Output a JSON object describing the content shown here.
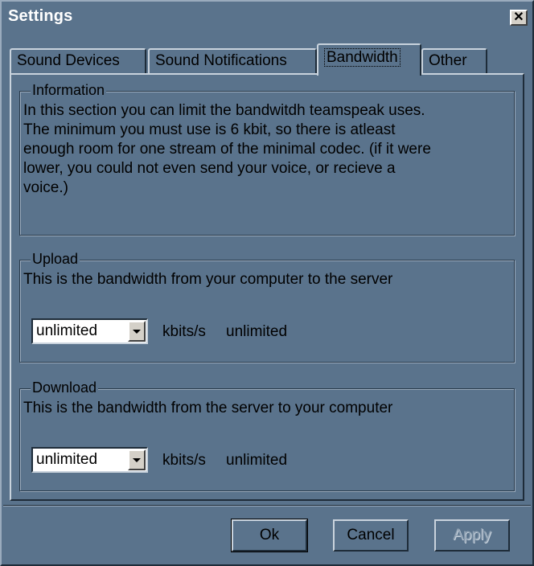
{
  "window": {
    "title": "Settings"
  },
  "tabs": [
    {
      "label": "Sound Devices"
    },
    {
      "label": "Sound Notifications"
    },
    {
      "label": "Bandwidth"
    },
    {
      "label": "Other"
    }
  ],
  "information": {
    "legend": "Information",
    "lines": [
      "In this section you can limit the bandwitdh teamspeak uses.",
      "The minimum you must use is 6 kbit, so there is atleast",
      "enough room for one stream of the minimal codec. (if it were",
      "lower, you could not even send your voice, or recieve a",
      "voice.)"
    ]
  },
  "upload": {
    "legend": "Upload",
    "description": "This is the bandwidth from your computer to the server",
    "selected": "unlimited",
    "unit": "kbits/s",
    "status": "unlimited"
  },
  "download": {
    "legend": "Download",
    "description": "This is the bandwidth from the server to your computer",
    "selected": "unlimited",
    "unit": "kbits/s",
    "status": "unlimited"
  },
  "buttons": {
    "ok": "Ok",
    "cancel": "Cancel",
    "apply": "Apply"
  }
}
